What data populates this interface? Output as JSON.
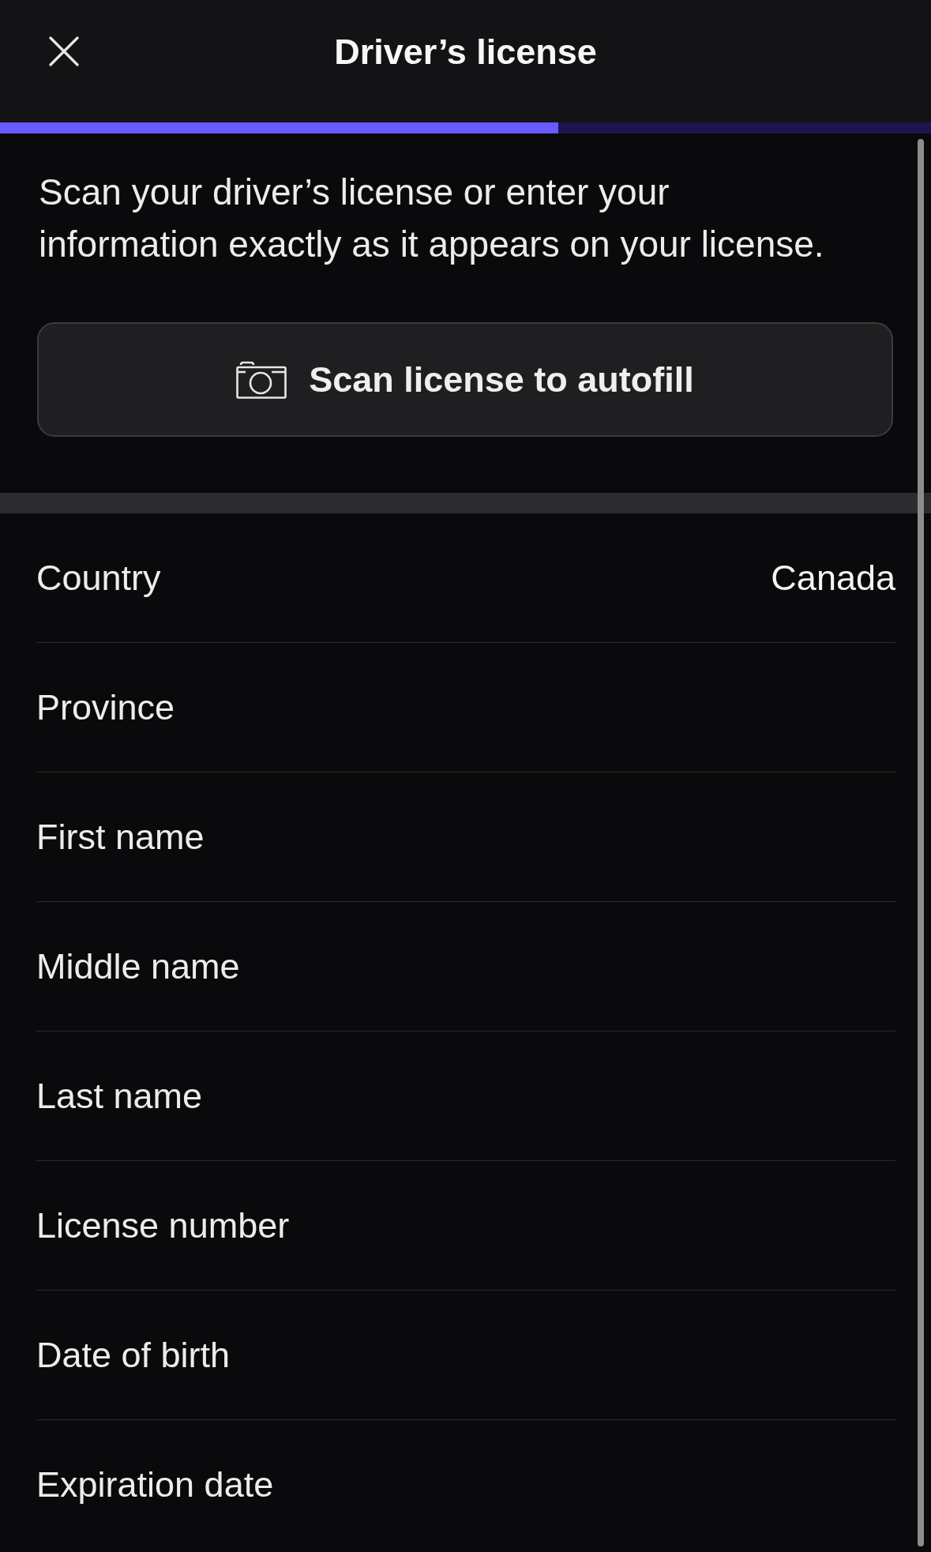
{
  "top_bar": {
    "title": "Driver’s license"
  },
  "progress": {
    "level": 0.6
  },
  "intro": "Scan your driver’s license or enter your information exactly as it appears on your license.",
  "scan_button": {
    "label": "Scan license to autofill"
  },
  "fields": [
    {
      "label": "Country",
      "value": "Canada"
    },
    {
      "label": "Province"
    },
    {
      "label": "First name"
    },
    {
      "label": "Middle name"
    },
    {
      "label": "Last name"
    },
    {
      "label": "License number"
    },
    {
      "label": "Date of birth"
    },
    {
      "label": "Expiration date"
    }
  ]
}
